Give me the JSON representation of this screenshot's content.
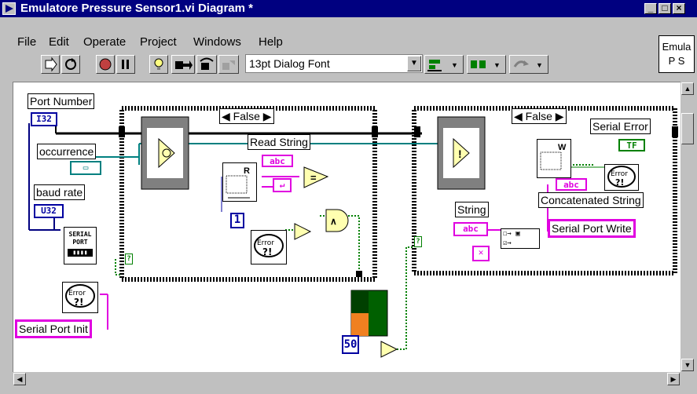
{
  "window": {
    "title": "Emulatore Pressure Sensor1.vi Diagram *",
    "vi_icon_text_1": "Emula",
    "vi_icon_text_2": "P S"
  },
  "menu": {
    "file": "File",
    "edit": "Edit",
    "operate": "Operate",
    "project": "Project",
    "windows": "Windows",
    "help": "Help"
  },
  "toolbar": {
    "font": "13pt Dialog Font"
  },
  "diagram": {
    "port_number": "Port Number",
    "i32": "I32",
    "occurrence": "occurrence",
    "baud_rate": "baud rate",
    "u32": "U32",
    "serial_port_1": "SERIAL",
    "serial_port_2": "PORT",
    "serial_port_init": "Serial Port Init",
    "case1_selector": "False",
    "case2_selector": "False",
    "read_string": "Read String",
    "abc": "abc",
    "const_1": "1",
    "const_50": "50",
    "string": "String",
    "serial_error": "Serial Error",
    "tf": "TF",
    "concatenated_string": "Concatenated String",
    "serial_port_write": "Serial Port Write",
    "read_r": "R",
    "write_w": "W",
    "error_txt": "Error"
  },
  "colors": {
    "title_bg": "#000080",
    "string_wire": "#e000e0",
    "error_wire": "#008000",
    "numeric": "#0000a0"
  }
}
